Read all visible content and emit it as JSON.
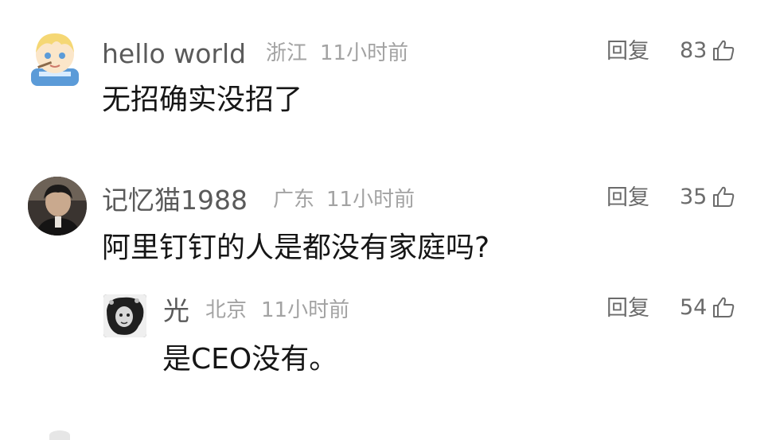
{
  "comments": [
    {
      "username": "hello world",
      "location": "浙江",
      "time": "11小时前",
      "reply_label": "回复",
      "likes": "83",
      "text": "无招确实没招了",
      "avatar_icon": "cartoon-boy-avatar"
    },
    {
      "username": "记忆猫1988",
      "location": "广东",
      "time": "11小时前",
      "reply_label": "回复",
      "likes": "35",
      "text": "阿里钉钉的人是都没有家庭吗?",
      "avatar_icon": "photo-avatar"
    }
  ],
  "replies": [
    {
      "username": "光",
      "location": "北京",
      "time": "11小时前",
      "reply_label": "回复",
      "likes": "54",
      "text": "是CEO没有。",
      "avatar_icon": "bw-portrait-avatar"
    }
  ],
  "colors": {
    "username": "#5a5a5a",
    "meta": "#a3a3a3",
    "action": "#6b6b6b",
    "text": "#161616"
  },
  "icons": [
    "thumbs-up-icon"
  ]
}
